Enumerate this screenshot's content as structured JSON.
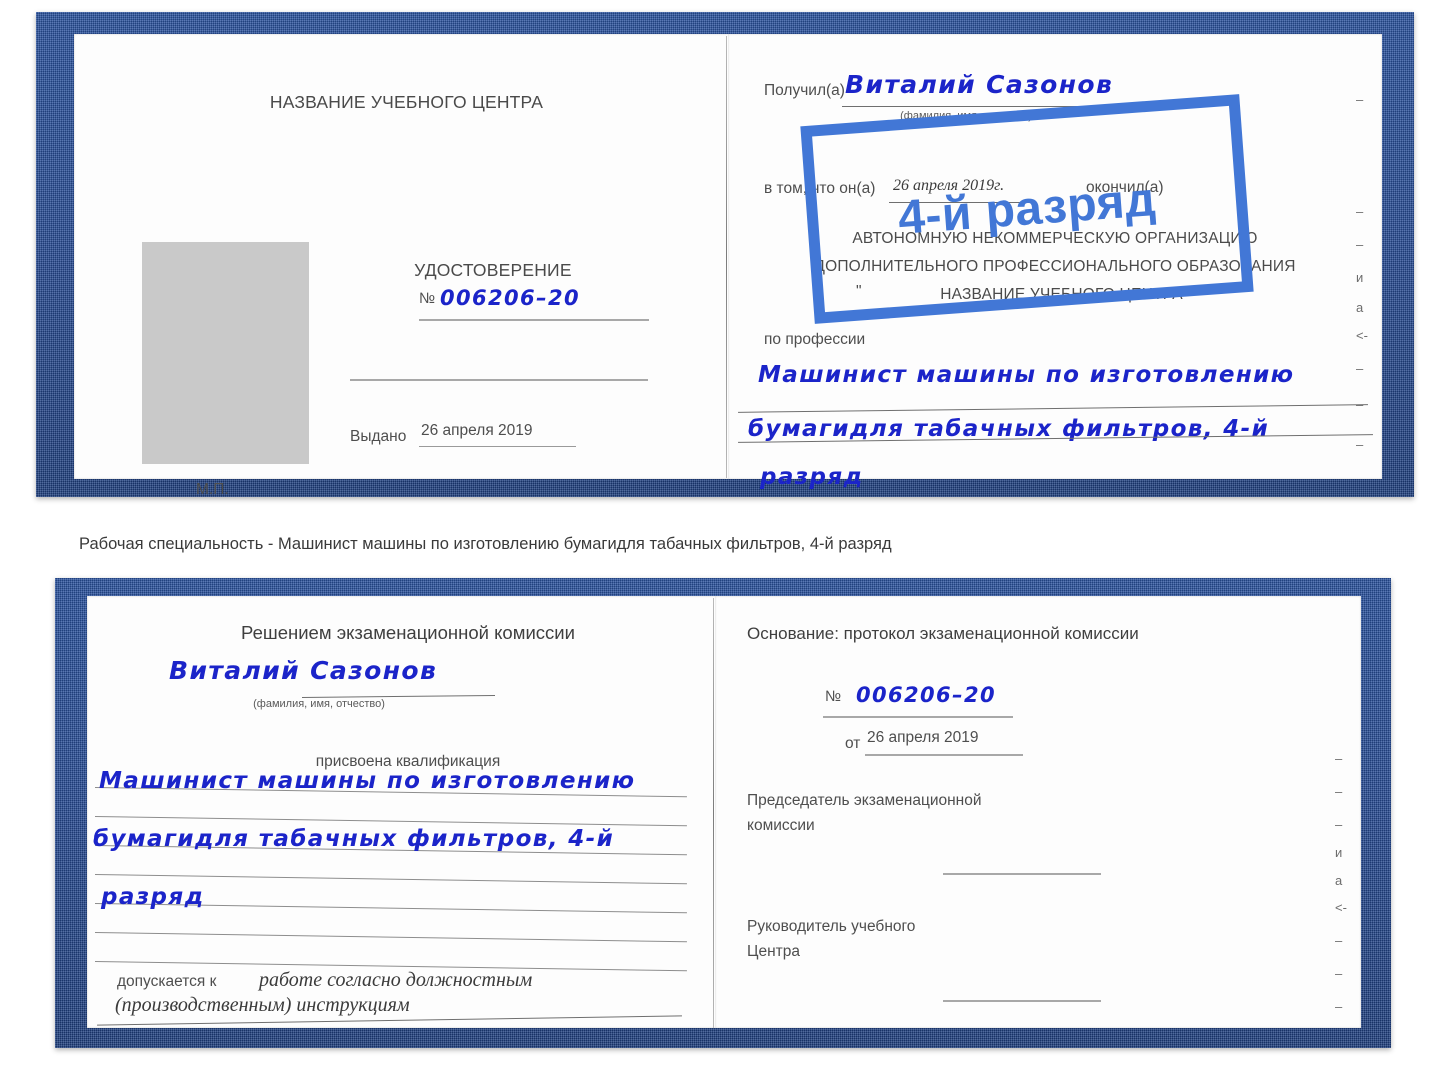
{
  "page": {
    "caption": "Рабочая специальность - Машинист машины по изготовлению бумагидля табачных фильтров, 4-й разряд"
  },
  "colors": {
    "cover": "#274c96",
    "ink": "#1b24c9",
    "stamp": "#4277d6",
    "paper": "#fdfdfd",
    "photo_placeholder": "#c9c9c9",
    "print_text": "#4c4c4c"
  },
  "watermark": {
    "text": "4-й разряд"
  },
  "certificate_top": {
    "left_page": {
      "header": "НАЗВАНИЕ УЧЕБНОГО ЦЕНТРА",
      "doc_title": "УДОСТОВЕРЕНИЕ",
      "number_label": "№",
      "number_value": "006206–20",
      "issued_label": "Выдано",
      "issued_value": "26 апреля 2019",
      "seal_label": "М.П.",
      "photo_alt": "photo-placeholder"
    },
    "right_page": {
      "received_label": "Получил(а)",
      "received_value": "Виталий Сазонов",
      "name_hint": "(фамилия, имя, отчество)",
      "that_he_label": "в том, что он(а)",
      "completion_date": "26 апреля 2019г.",
      "finished_label": "окончил(а)",
      "org_line1": "АВТОНОМНУЮ НЕКОММЕРЧЕСКУЮ ОРГАНИЗАЦИЮ",
      "org_line2": "ДОПОЛНИТЕЛЬНОГО ПРОФЕССИОНАЛЬНОГО ОБРАЗОВАНИЯ",
      "org_quote_open": "\"",
      "org_line3": "НАЗВАНИЕ УЧЕБНОГО ЦЕНТРА",
      "org_quote_close": "\"",
      "profession_label": "по профессии",
      "profession_line1": "Машинист машины по изготовлению",
      "profession_line2": "бумагидля табачных фильтров, 4-й",
      "profession_line3": "разряд"
    },
    "edge_marks": [
      "–",
      "–",
      "–",
      "и",
      "а",
      "<-",
      "–",
      "–",
      "–"
    ]
  },
  "certificate_bottom": {
    "left_page": {
      "header": "Решением экзаменационной комиссии",
      "name_value": "Виталий Сазонов",
      "name_hint": "(фамилия, имя, отчество)",
      "qualification_label": "присвоена квалификация",
      "qualification_line1": "Машинист машины по изготовлению",
      "qualification_line2": "бумагидля табачных фильтров, 4-й",
      "qualification_line3": "разряд",
      "admitted_label": "допускается к",
      "admitted_line1": "работе согласно должностным",
      "admitted_line2": "(производственным) инструкциям"
    },
    "right_page": {
      "basis_label": "Основание: протокол экзаменационной комиссии",
      "number_label": "№",
      "number_value": "006206–20",
      "date_label": "от",
      "date_value": "26 апреля 2019",
      "chairman_line1": "Председатель экзаменационной",
      "chairman_line2": "комиссии",
      "head_line1": "Руководитель учебного",
      "head_line2": "Центра"
    },
    "edge_marks": [
      "–",
      "–",
      "–",
      "и",
      "а",
      "<-",
      "–",
      "–",
      "–"
    ]
  }
}
